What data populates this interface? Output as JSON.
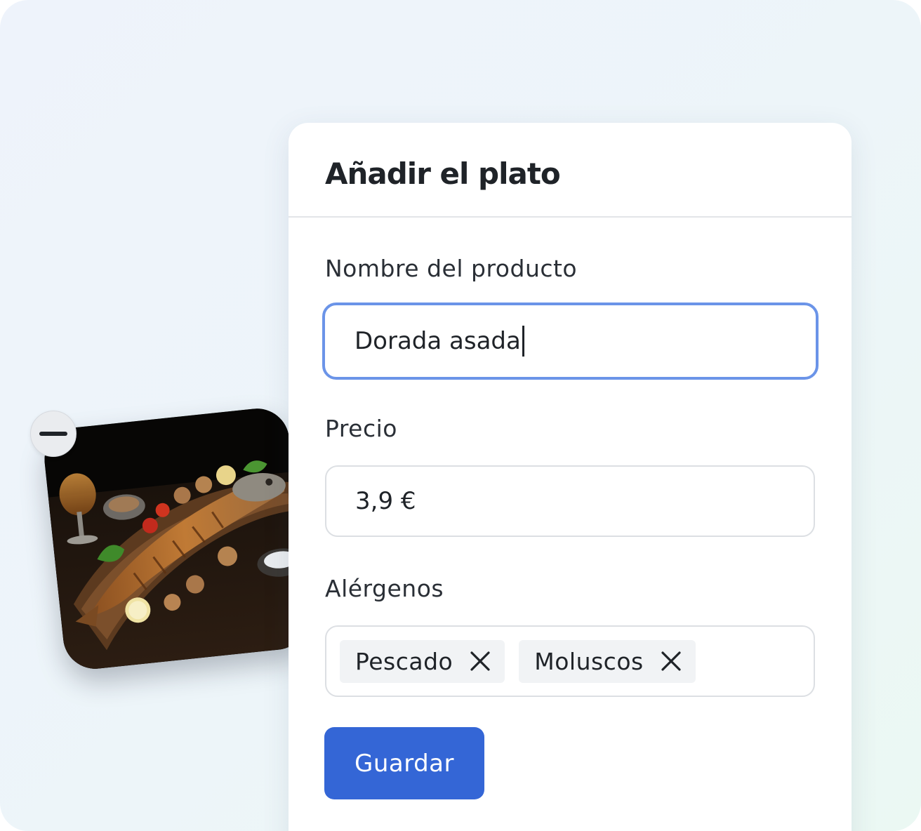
{
  "dialog": {
    "title": "Añadir el plato"
  },
  "form": {
    "name": {
      "label": "Nombre del producto",
      "value": "Dorada asada"
    },
    "price": {
      "label": "Precio",
      "value": "3,9 €"
    },
    "allergens": {
      "label": "Alérgenos",
      "tags": [
        {
          "label": "Pescado",
          "remove_icon": "close-icon"
        },
        {
          "label": "Moluscos",
          "remove_icon": "close-icon"
        }
      ]
    },
    "save_label": "Guardar"
  },
  "photo": {
    "subject": "grilled sea bream dish",
    "remove_icon": "minus-icon"
  },
  "colors": {
    "accent": "#3466d6",
    "focus_border": "#6b94e8",
    "chip_bg": "#f1f3f5"
  }
}
